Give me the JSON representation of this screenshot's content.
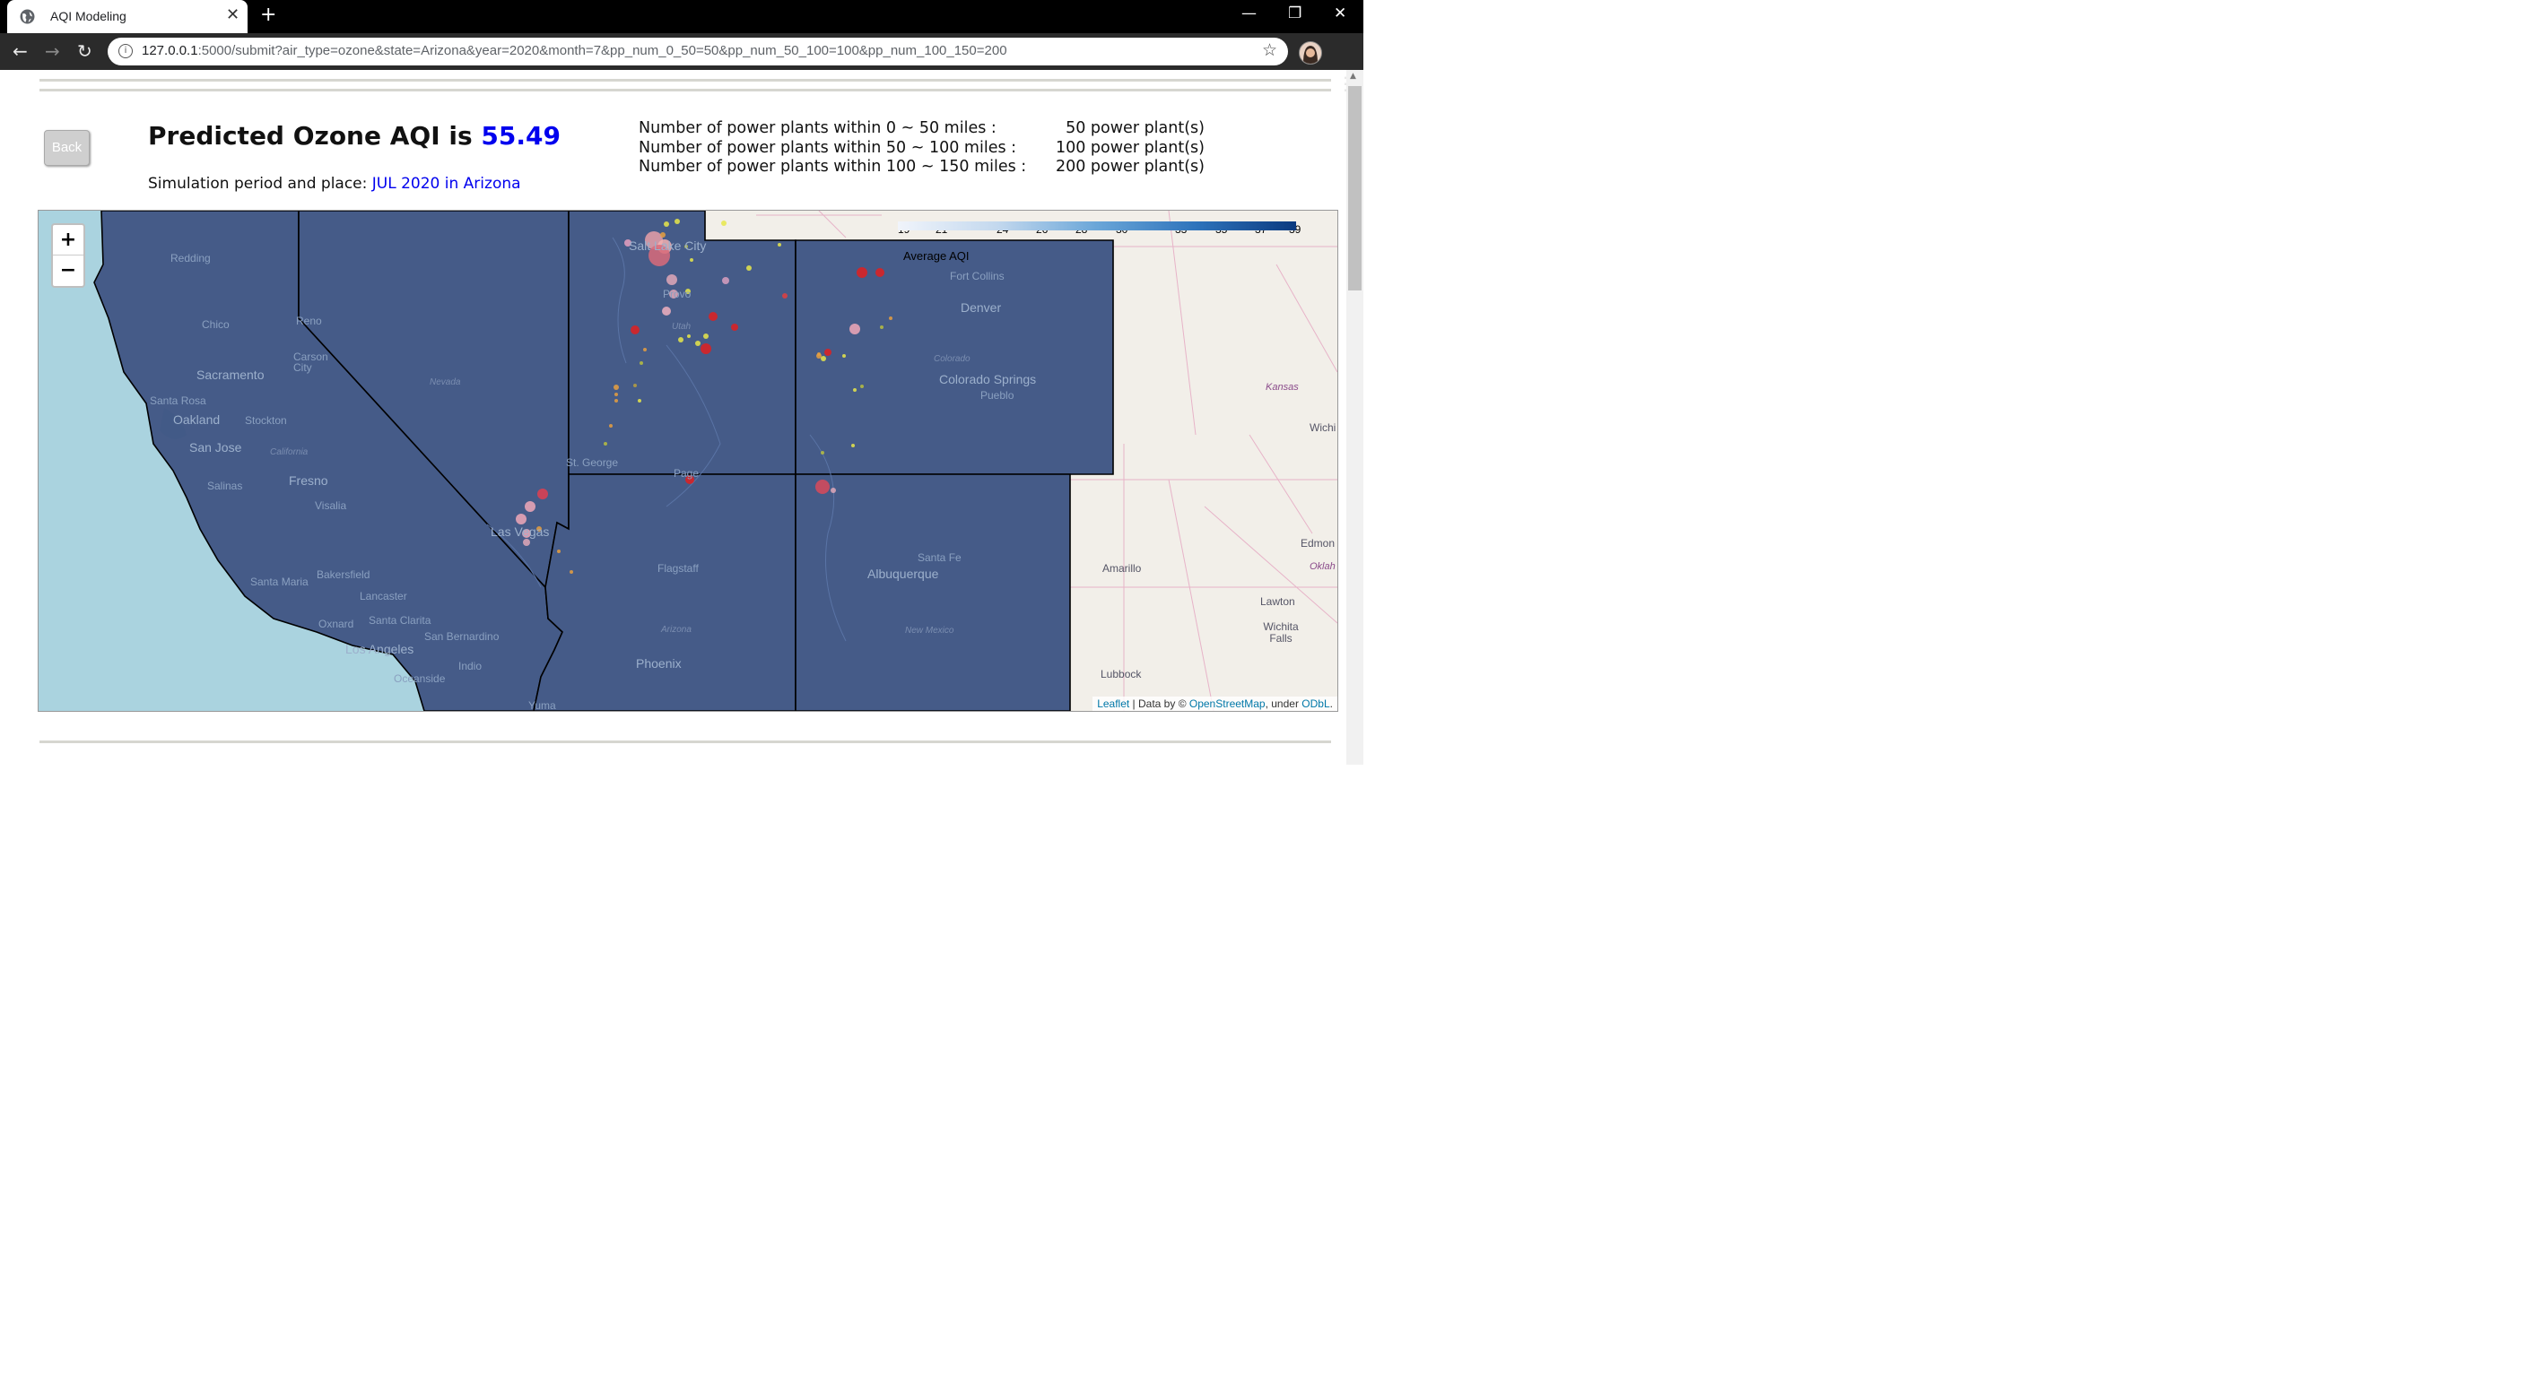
{
  "browser": {
    "tab_title": "AQI Modeling",
    "url_host": "127.0.0.1",
    "url_rest": ":5000/submit?air_type=ozone&state=Arizona&year=2020&month=7&pp_num_0_50=50&pp_num_50_100=100&pp_num_100_150=200",
    "tab_close": "✕",
    "new_tab": "+",
    "minimize": "—",
    "restore": "❐",
    "close": "✕",
    "back": "←",
    "forward": "→",
    "reload": "↻",
    "star": "☆",
    "menu": "⋮",
    "info": "i"
  },
  "header": {
    "back_label": "Back",
    "title_prefix": "Predicted Ozone AQI is ",
    "aqi_value": "55.49",
    "period_prefix": "Simulation period and place: ",
    "period_value": "JUL 2020 in Arizona"
  },
  "power_plants": [
    {
      "label": "Number of power plants within 0 ~ 50 miles :",
      "count": "50 power plant(s)"
    },
    {
      "label": "Number of power plants within 50 ~ 100 miles :",
      "count": "100 power plant(s)"
    },
    {
      "label": "Number of power plants within 100 ~ 150 miles :",
      "count": "200 power plant(s)"
    }
  ],
  "map": {
    "zoom_in": "+",
    "zoom_out": "−",
    "legend": {
      "title": "Average AQI",
      "ticks": [
        "19",
        "21",
        "24",
        "26",
        "28",
        "30",
        "33",
        "35",
        "37",
        "39"
      ]
    },
    "attribution": {
      "leaflet": "Leaflet",
      "sep": " | Data by © ",
      "osm": "OpenStreetMap",
      "under": ", under ",
      "odbl": "ODbL",
      "end": "."
    },
    "cities": {
      "redding": "Redding",
      "chico": "Chico",
      "sacramento": "Sacramento",
      "santa_rosa": "Santa Rosa",
      "oakland": "Oakland",
      "stockton": "Stockton",
      "san_jose": "San Jose",
      "salinas": "Salinas",
      "fresno": "Fresno",
      "visalia": "Visalia",
      "santa_maria": "Santa Maria",
      "bakersfield": "Bakersfield",
      "lancaster": "Lancaster",
      "oxnard": "Oxnard",
      "santa_clarita": "Santa Clarita",
      "san_bernardino": "San Bernardino",
      "los_angeles": "Los Angeles",
      "oceanside": "Oceanside",
      "indio": "Indio",
      "yuma": "Yuma",
      "reno": "Reno",
      "carson_city": "Carson City",
      "las_vegas": "Las Vegas",
      "st_george": "St. George",
      "salt_lake_city": "Salt Lake City",
      "provo": "Provo",
      "page": "Page",
      "flagstaff": "Flagstaff",
      "phoenix": "Phoenix",
      "fort_collins": "Fort Collins",
      "denver": "Denver",
      "colorado_springs": "Colorado Springs",
      "pueblo": "Pueblo",
      "santa_fe": "Santa Fe",
      "albuquerque": "Albuquerque",
      "amarillo": "Amarillo",
      "lubbock": "Lubbock",
      "lawton": "Lawton",
      "wichita_falls": "Wichita Falls",
      "edmond": "Edmon",
      "wichita": "Wichi",
      "oklahoma": "Oklah"
    },
    "states": {
      "california": "California",
      "nevada": "Nevada",
      "utah": "Utah",
      "arizona": "Arizona",
      "colorado": "Colorado",
      "new_mexico": "New Mexico",
      "kansas": "Kansas"
    },
    "colors": {
      "overlay": "#3f5684",
      "ocean": "#aad3df",
      "land": "#f2efe9"
    }
  }
}
